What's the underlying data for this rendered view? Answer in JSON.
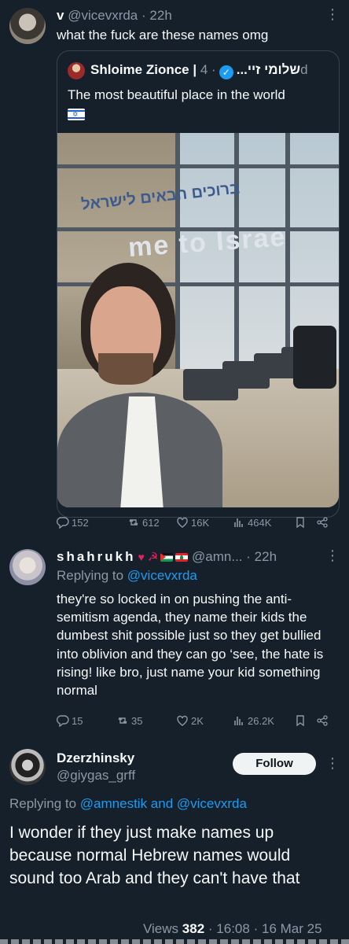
{
  "tweet1": {
    "author_letter": "v",
    "handle": "@vicevxrda",
    "time": "22h",
    "text": "what the fuck are these names omg",
    "quote": {
      "name": "Shloime Zionce | שלומי זיי...",
      "verified_icon": "verified-badge",
      "time": "4d",
      "text": "The most beautiful place in the world",
      "photo_sign_hebrew": "ברוכים הבאים לישראל",
      "photo_sign_english": "me to Israe"
    },
    "metrics": {
      "replies": "152",
      "reposts": "612",
      "likes": "16K",
      "views": "464K"
    }
  },
  "tweet2": {
    "name": "shahrukh",
    "handle": "@amn...",
    "time": "22h",
    "replying_prefix": "Replying to",
    "replying_to": "@vicevxrda",
    "text": "they're so locked in on pushing the anti-semitism agenda, they name their kids the dumbest shit possible just so they get bullied into oblivion and they can go ‘see, the hate is rising! like bro, just name your kid something normal",
    "metrics": {
      "replies": "15",
      "reposts": "35",
      "likes": "2K",
      "views": "26.2K"
    }
  },
  "tweet3": {
    "name": "Dzerzhinsky",
    "handle": "@giygas_grff",
    "follow_label": "Follow",
    "replying_prefix": "Replying to",
    "replying_to": "@amnestik and @vicevxrda",
    "text": "I wonder if they just make names up because normal Hebrew names would sound too Arab and they can't have that",
    "views_label": "Views",
    "views": "382",
    "time": "16:08",
    "date": "16 Mar 25"
  },
  "colors": {
    "background": "#15202b",
    "text": "#f7f9f9",
    "muted": "#8b98a5",
    "link": "#1d9bf0",
    "border": "#38444d"
  }
}
